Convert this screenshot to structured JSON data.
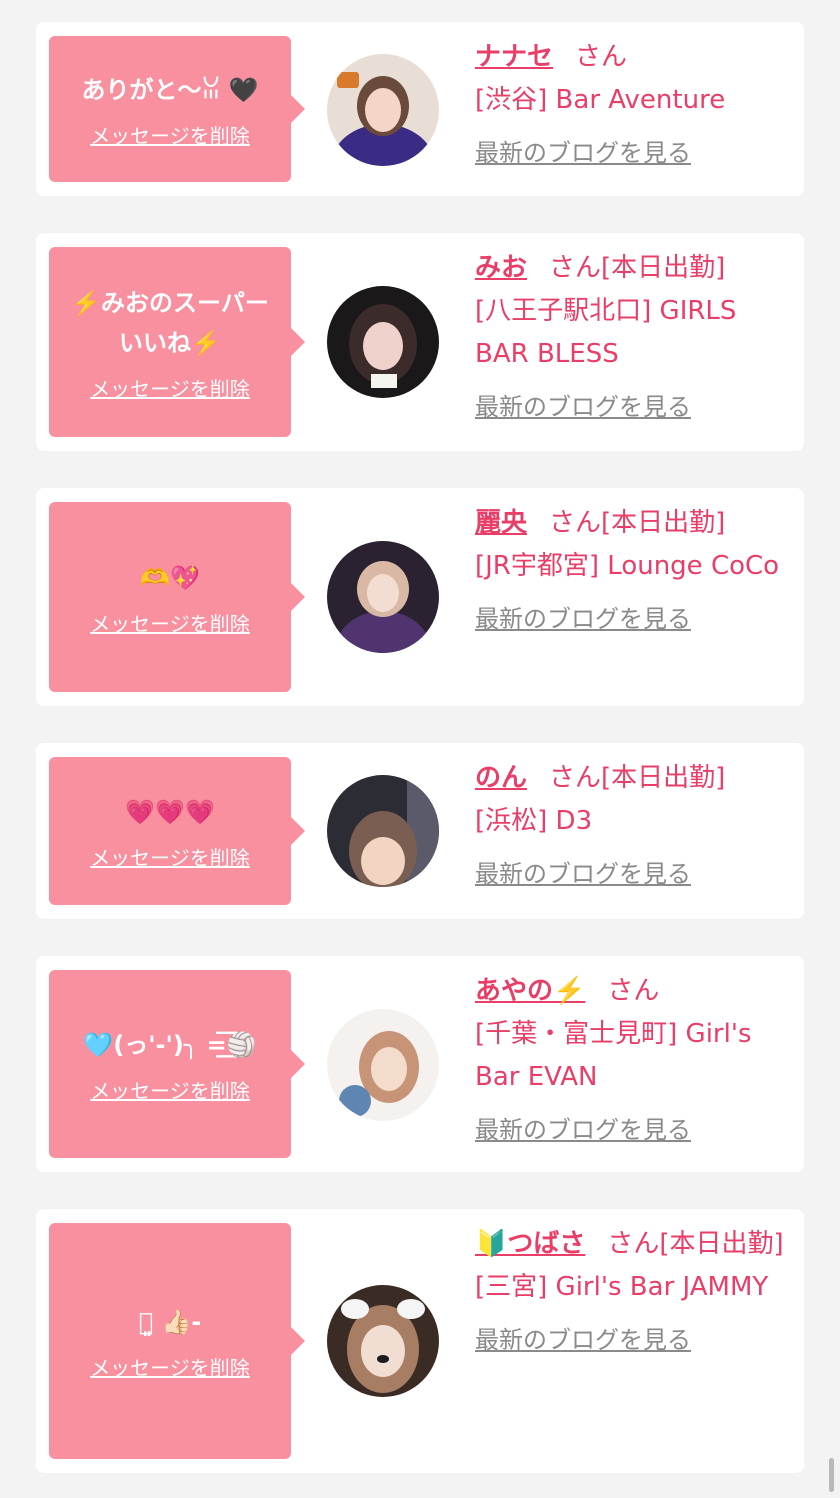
{
  "delete_label": "メッセージを削除",
  "blog_label": "最新のブログを見る",
  "san_suffix": "さん",
  "cards": [
    {
      "message": "ありがと〜ꈍ 🖤",
      "name": "ナナセ",
      "name_suffix": "さん",
      "shop": "[渋谷] Bar Aventure",
      "avatar": "avatar-photo",
      "avatar_colors": [
        "#2b1d5e",
        "#6a4ea8",
        "#e4d4c8"
      ]
    },
    {
      "message": "⚡️みおのスーパー\nいいね⚡️",
      "name": "みお",
      "name_suffix": "さん[本日出勤]",
      "shop": "[八王子駅北口] GIRLS BAR BLESS",
      "avatar": "avatar-photo",
      "avatar_colors": [
        "#1a1818",
        "#4a3b3b",
        "#e9c9c5"
      ]
    },
    {
      "message": "🫶💖",
      "name": "麗央",
      "name_suffix": "さん[本日出勤]",
      "shop": "[JR宇都宮] Lounge CoCo",
      "avatar": "avatar-photo",
      "avatar_colors": [
        "#2a2230",
        "#5e3c7d",
        "#f0d9cf"
      ]
    },
    {
      "message": "💗💗💗",
      "name": "のん",
      "name_suffix": "さん[本日出勤]",
      "shop": "[浜松] D3",
      "avatar": "avatar-photo",
      "avatar_colors": [
        "#2c2c34",
        "#6b5a53",
        "#edd0bd"
      ]
    },
    {
      "message": "🩵(っ'-')╮ =͟͟͞͞🏐",
      "name": "あやの⚡️",
      "name_suffix": "さん",
      "shop": "[千葉・富士見町] Girl's Bar EVAN",
      "avatar": "avatar-photo",
      "avatar_colors": [
        "#f4f1ee",
        "#d9b59d",
        "#6d8fb6"
      ]
    },
    {
      "message": "ꈍ͈ 👍🏻-",
      "name": "🔰つばさ",
      "name_suffix": "さん[本日出勤]",
      "shop": "[三宮] Girl's Bar JAMMY",
      "avatar": "avatar-photo",
      "avatar_colors": [
        "#3a2b24",
        "#a77d63",
        "#f1ddd2"
      ]
    }
  ]
}
